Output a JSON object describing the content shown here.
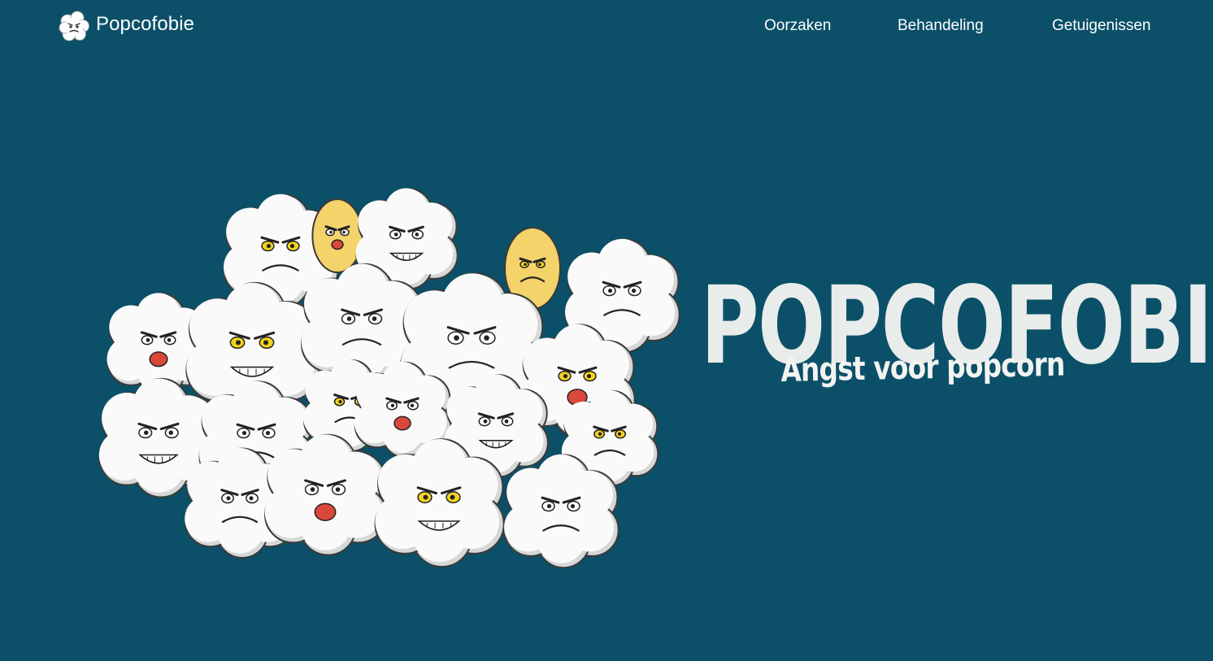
{
  "colors": {
    "background": "#0b5068",
    "nav_text": "#ffffff",
    "title_text": "#e8ecea",
    "kernel_white": "#fafafa",
    "kernel_shadow": "#d6d8d8",
    "kernel_outline": "#3a3a3a",
    "kernel_yellow": "#f3d36a",
    "mouth_red": "#d9483b"
  },
  "navbar": {
    "brand_label": "Popcofobie",
    "brand_icon": "popcorn-logo-icon",
    "links": [
      {
        "label": "Oorzaken"
      },
      {
        "label": "Behandeling"
      },
      {
        "label": "Getuigenissen"
      }
    ]
  },
  "hero": {
    "title": "POPCOFOBIE",
    "subtitle": "Angst voor popcorn",
    "illustration_icon": "angry-popcorn-pile-illustration"
  }
}
